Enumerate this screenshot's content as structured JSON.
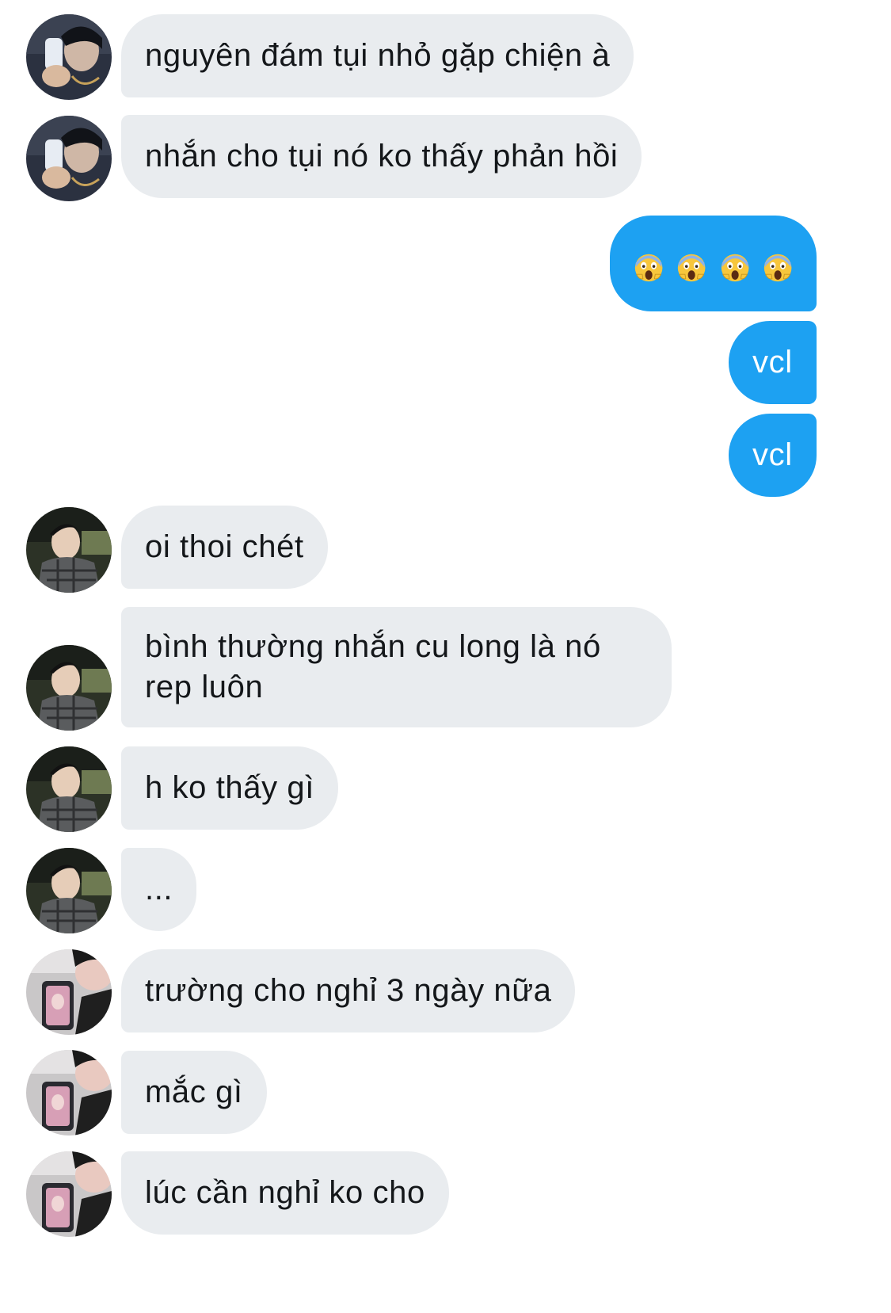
{
  "colors": {
    "incoming_bubble": "#e9ecef",
    "outgoing_bubble": "#1da1f2",
    "incoming_text": "#14171a",
    "outgoing_text": "#ffffff"
  },
  "messages": [
    {
      "direction": "in",
      "avatar": "avatar-a",
      "text": "nguyên đám tụi nhỏ gặp chiện à"
    },
    {
      "direction": "in",
      "avatar": "avatar-a",
      "text": "nhắn cho tụi nó ko thấy phản hồi"
    },
    {
      "direction": "out",
      "emoji": [
        "face-screaming-in-fear-icon",
        "face-screaming-in-fear-icon",
        "face-screaming-in-fear-icon",
        "face-screaming-in-fear-icon"
      ]
    },
    {
      "direction": "out",
      "text": "vcl"
    },
    {
      "direction": "out",
      "text": "vcl"
    },
    {
      "direction": "in",
      "avatar": "avatar-b",
      "text": "oi thoi chét"
    },
    {
      "direction": "in",
      "avatar": "avatar-b",
      "text": "bình thường nhắn cu long là nó rep luôn"
    },
    {
      "direction": "in",
      "avatar": "avatar-b",
      "text": "h ko thấy gì"
    },
    {
      "direction": "in",
      "avatar": "avatar-b",
      "text": "..."
    },
    {
      "direction": "in",
      "avatar": "avatar-c",
      "text": "trường cho nghỉ 3 ngày nữa"
    },
    {
      "direction": "in",
      "avatar": "avatar-c",
      "text": "mắc gì"
    },
    {
      "direction": "in",
      "avatar": "avatar-c",
      "text": "lúc cần nghỉ ko cho"
    }
  ]
}
